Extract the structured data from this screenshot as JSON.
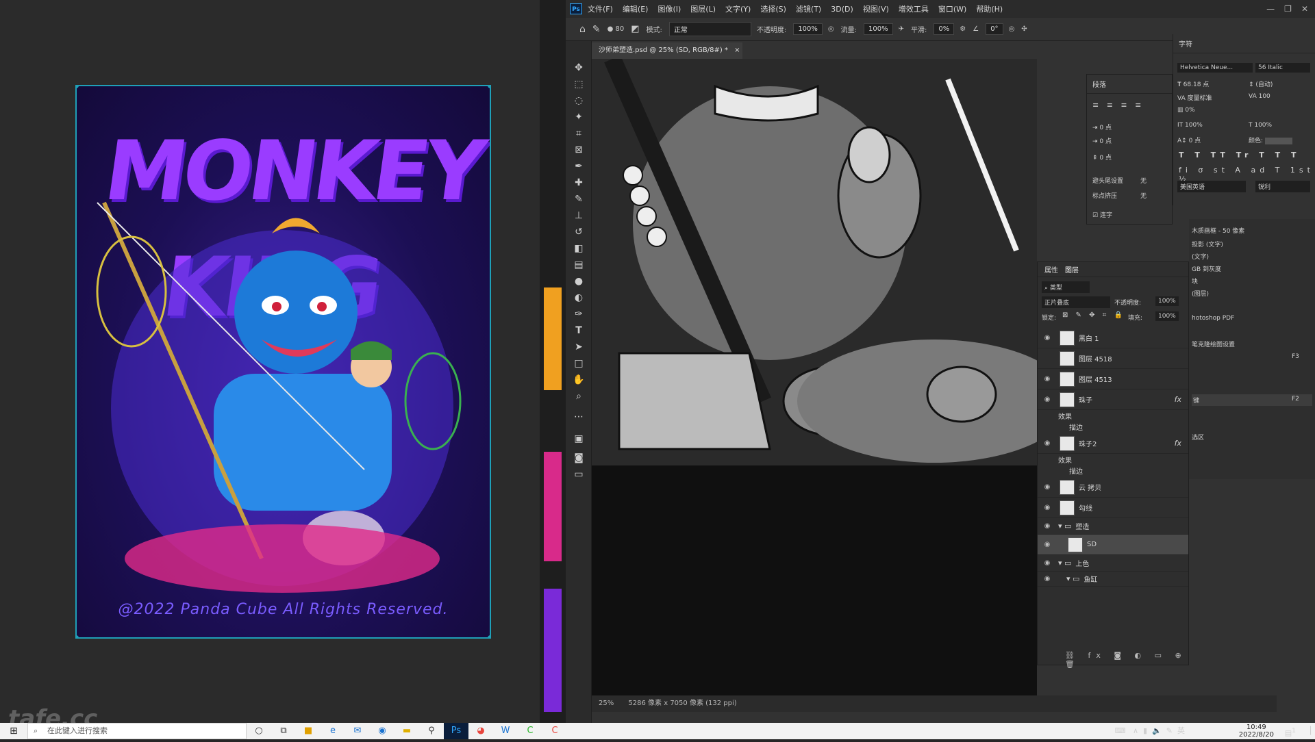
{
  "artwork": {
    "title": "MONKEY KING",
    "copyright": "@2022 Panda Cube All Rights Reserved."
  },
  "watermark": "tafe.cc",
  "photoshop": {
    "logo": "Ps",
    "menu": [
      "文件(F)",
      "编辑(E)",
      "图像(I)",
      "图层(L)",
      "文字(Y)",
      "选择(S)",
      "滤镜(T)",
      "3D(D)",
      "视图(V)",
      "增效工具",
      "窗口(W)",
      "帮助(H)"
    ],
    "options": {
      "brush_size": "80",
      "mode_label": "模式:",
      "mode_value": "正常",
      "opacity_label": "不透明度:",
      "opacity_value": "100%",
      "flow_label": "流量:",
      "flow_value": "100%",
      "smooth_label": "平滑:",
      "smooth_value": "0%",
      "angle_value": "0°"
    },
    "doc_tab": "沙师弟塑造.psd @ 25% (SD, RGB/8#) *",
    "status": {
      "zoom": "25%",
      "doc_info": "5286 像素 x 7050 像素 (132 ppi)"
    },
    "character_panel": {
      "title": "字符",
      "font_family": "Helvetica Neue...",
      "font_style": "56 Italic",
      "font_size": "68.18 点",
      "leading": "(自动)",
      "kerning": "度量标准",
      "tracking": "100",
      "tsume": "0%",
      "vscale": "100%",
      "hscale": "100%",
      "baseline": "0 点",
      "color_label": "颜色:",
      "language": "美国英语",
      "aa": "锐利"
    },
    "paragraph_panel": {
      "title": "段落",
      "indent1": "0 点",
      "indent2": "0 点",
      "indent3": "0 点",
      "hyph_label": "避头尾设置",
      "hyph_value": "无",
      "comp_label": "标点挤压",
      "comp_value": "无",
      "ligature_label": "连字"
    },
    "layers_panel": {
      "tab_properties": "属性",
      "tab_layers": "图层",
      "filter_label": "类型",
      "blend_mode": "正片叠底",
      "opacity_label": "不透明度:",
      "opacity_value": "100%",
      "lock_label": "锁定:",
      "fill_label": "填充:",
      "fill_value": "100%",
      "layers": [
        {
          "name": "黑白 1",
          "visible": true
        },
        {
          "name": "图层 4518",
          "visible": false
        },
        {
          "name": "图层 4513",
          "visible": true
        },
        {
          "name": "珠子",
          "visible": true,
          "fx": "fx"
        },
        {
          "name": "效果",
          "visible": true,
          "sub": true
        },
        {
          "name": "描边",
          "visible": true,
          "sub": true
        },
        {
          "name": "珠子2",
          "visible": true,
          "fx": "fx"
        },
        {
          "name": "效果",
          "visible": true,
          "sub": true
        },
        {
          "name": "描边",
          "visible": true,
          "sub": true
        },
        {
          "name": "云 拷贝",
          "visible": true
        },
        {
          "name": "勾线",
          "visible": true
        },
        {
          "name": "塑造",
          "visible": true,
          "group": true
        },
        {
          "name": "SD",
          "visible": true,
          "selected": true
        },
        {
          "name": "上色",
          "visible": true,
          "group": true
        },
        {
          "name": "鱼缸",
          "visible": true,
          "group": true
        }
      ]
    },
    "right_panel_items": [
      "木质画框 - 50 像素",
      "投影 (文字)",
      "(文字)",
      "GB 到灰度",
      "块",
      "(图层)",
      "hotoshop PDF",
      "笔克隆绘图设置",
      "F3",
      "键",
      "F2",
      "选区"
    ]
  },
  "taskbar": {
    "search_placeholder": "在此键入进行搜索",
    "ime": "英",
    "time": "10:49",
    "date": "2022/8/20",
    "notification_count": "1"
  }
}
